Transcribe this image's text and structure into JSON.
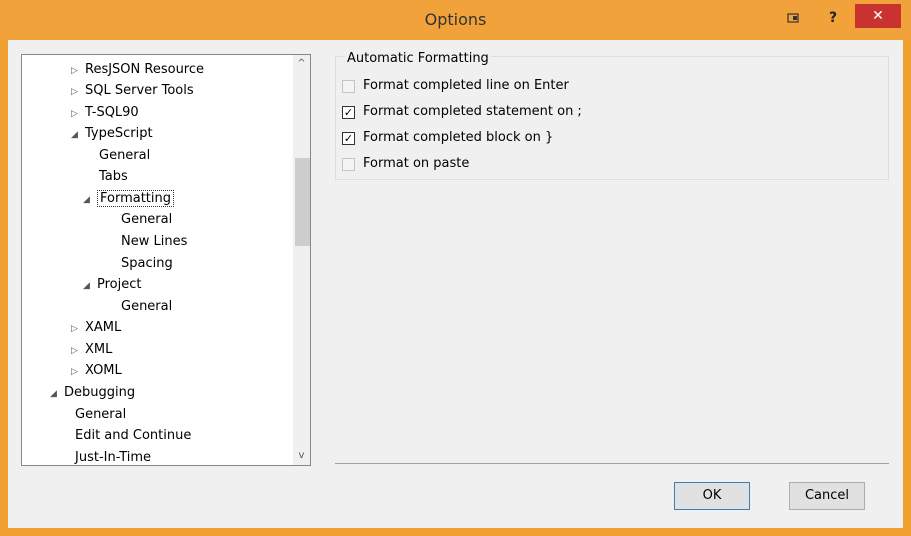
{
  "window": {
    "title": "Options",
    "help_glyph": "?",
    "close_glyph": "✕"
  },
  "tree": {
    "items": [
      {
        "label": "ResJSON Resource",
        "expander": "▷"
      },
      {
        "label": "SQL Server Tools",
        "expander": "▷"
      },
      {
        "label": "T-SQL90",
        "expander": "▷"
      },
      {
        "label": "TypeScript",
        "expander": "◢"
      },
      {
        "label": "General",
        "expander": ""
      },
      {
        "label": "Tabs",
        "expander": ""
      },
      {
        "label": "Formatting",
        "expander": "◢",
        "selected": true
      },
      {
        "label": "General",
        "expander": ""
      },
      {
        "label": "New Lines",
        "expander": ""
      },
      {
        "label": "Spacing",
        "expander": ""
      },
      {
        "label": "Project",
        "expander": "◢"
      },
      {
        "label": "General",
        "expander": ""
      },
      {
        "label": "XAML",
        "expander": "▷"
      },
      {
        "label": "XML",
        "expander": "▷"
      },
      {
        "label": "XOML",
        "expander": "▷"
      },
      {
        "label": "Debugging",
        "expander": "◢"
      },
      {
        "label": "General",
        "expander": ""
      },
      {
        "label": "Edit and Continue",
        "expander": ""
      },
      {
        "label": "Just-In-Time",
        "expander": ""
      }
    ],
    "scroll_up": "^",
    "scroll_down": "v"
  },
  "settings": {
    "group_label": "Automatic Formatting",
    "options": [
      {
        "label": "Format completed line on Enter",
        "checked": false
      },
      {
        "label": "Format completed statement on ;",
        "checked": true
      },
      {
        "label": "Format completed block on }",
        "checked": true
      },
      {
        "label": "Format on paste",
        "checked": false
      }
    ]
  },
  "buttons": {
    "ok": "OK",
    "cancel": "Cancel"
  },
  "colors": {
    "title_bar": "#f2a23a",
    "close_button": "#c8322f"
  }
}
